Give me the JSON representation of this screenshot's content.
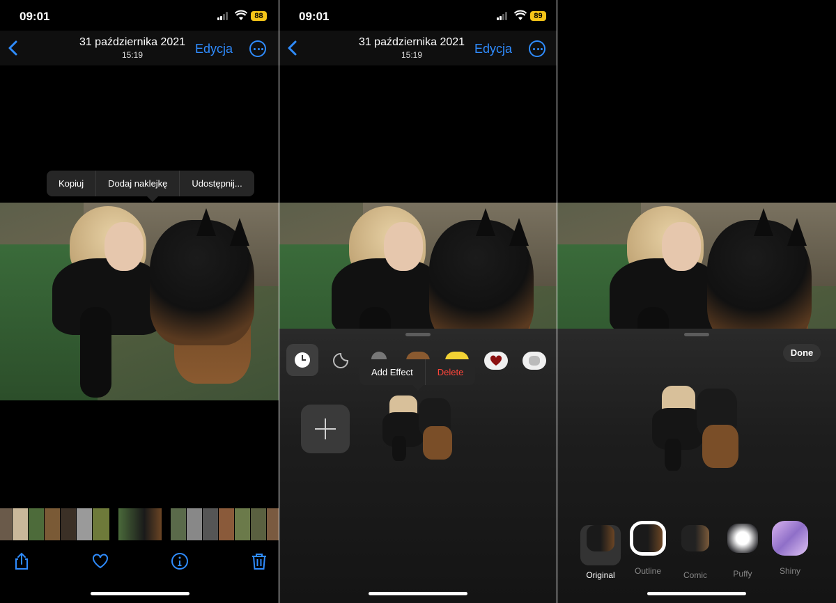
{
  "status": {
    "time": "09:01",
    "battery_left": "88",
    "battery_mid": "89"
  },
  "nav": {
    "date": "31 października 2021",
    "time": "15:19",
    "edit_label": "Edycja"
  },
  "callout": {
    "copy": "Kopiuj",
    "add_sticker": "Dodaj naklejkę",
    "share": "Udostępnij..."
  },
  "sticker_menu": {
    "add_effect": "Add Effect",
    "delete": "Delete"
  },
  "effects_panel": {
    "done_label": "Done",
    "effects": [
      "Original",
      "Outline",
      "Comic",
      "Puffy",
      "Shiny"
    ],
    "selected": "Original"
  },
  "colors": {
    "accent": "#2f8cff",
    "destructive": "#ff453a",
    "callout_bg": "#262626"
  },
  "icons": {
    "back": "chevron-left-icon",
    "more": "ellipsis-circle-icon",
    "share": "share-icon",
    "favorite": "heart-icon",
    "info": "info-icon",
    "delete": "trash-icon",
    "recents": "clock-icon",
    "stickers": "sticker-icon",
    "add": "plus-icon"
  }
}
